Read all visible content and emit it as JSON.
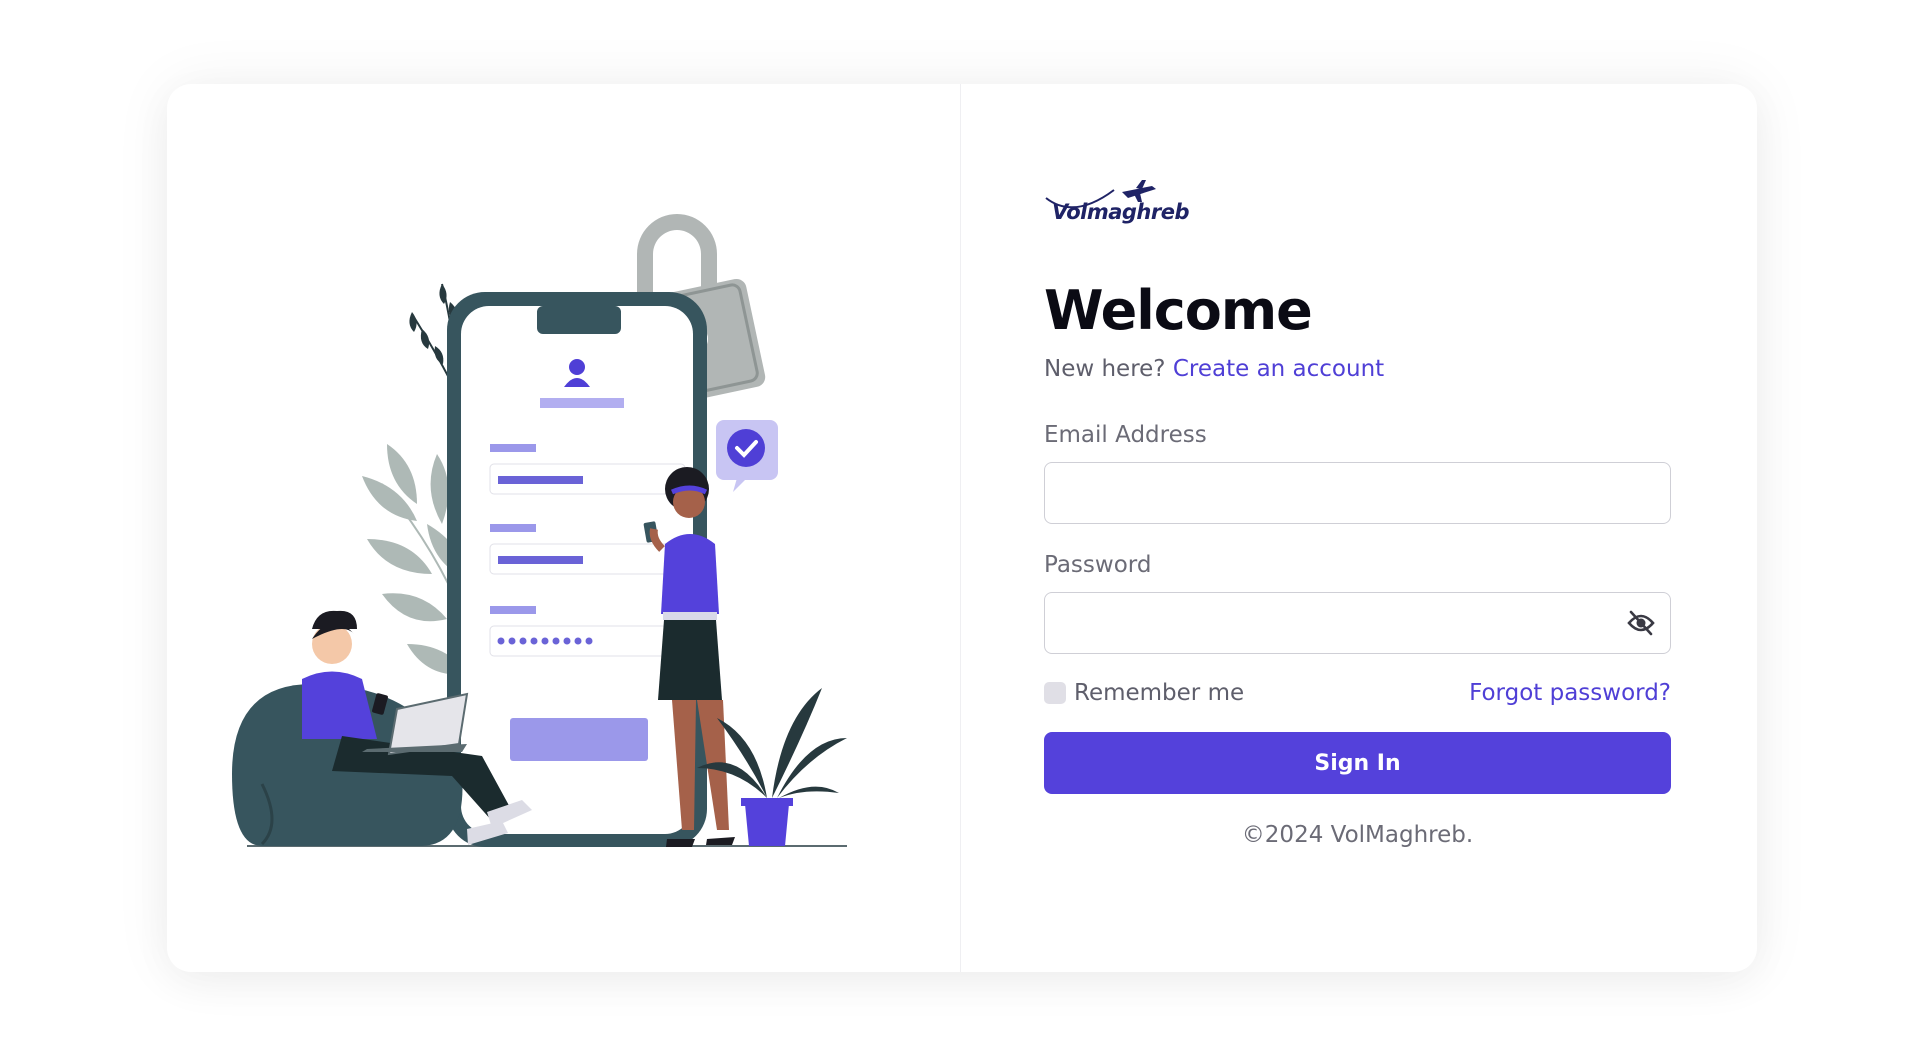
{
  "brand": {
    "logo_text": "Volmaghreb"
  },
  "colors": {
    "accent": "#5441db",
    "link": "#4f3fd6",
    "illustration_dark": "#37555e",
    "illustration_light": "#9b98ea"
  },
  "form": {
    "title": "Welcome",
    "new_here_text": "New here?",
    "create_account_link": "Create an account",
    "email_label": "Email Address",
    "email_value": "",
    "password_label": "Password",
    "password_value": "",
    "password_toggle_icon": "eye-off-icon",
    "remember_label": "Remember me",
    "remember_checked": false,
    "forgot_link": "Forgot password?",
    "submit_label": "Sign In"
  },
  "footer": {
    "copyright": "©2024 VolMaghreb."
  },
  "illustration": {
    "icons": [
      "lock-icon",
      "user-icon",
      "check-icon",
      "phone-icon",
      "laptop-icon",
      "plant-icon"
    ]
  }
}
